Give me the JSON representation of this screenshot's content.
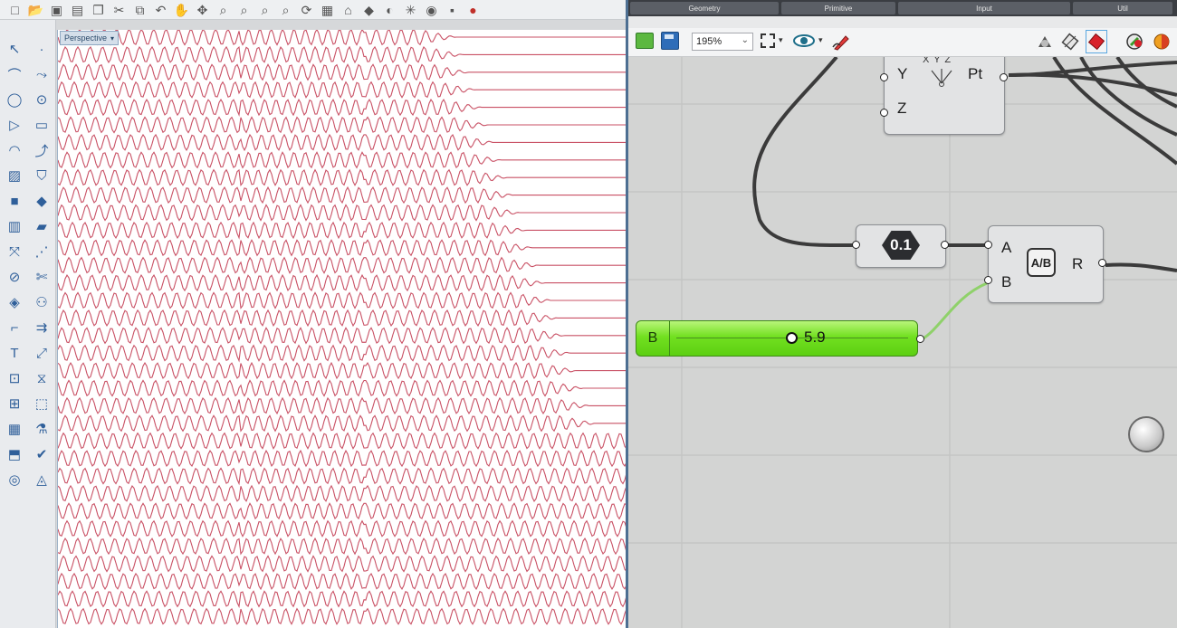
{
  "rhino": {
    "viewport_tab": "Perspective",
    "toolbar_icons": [
      "new-file-icon",
      "open-folder-icon",
      "save-icon",
      "print-icon",
      "paste-icon",
      "cut-icon",
      "copy-icon",
      "undo-icon",
      "pan-hand-icon",
      "move-arrows-icon",
      "zoom-icon",
      "zoom-window-icon",
      "zoom-extents-icon",
      "zoom-selected-icon",
      "rotate-view-icon",
      "grid-icon",
      "set-view-icon",
      "shaded-icon",
      "snapshot-icon",
      "points-icon",
      "light-bulb-icon",
      "lock-icon",
      "render-icon"
    ],
    "side_icons": [
      "select-arrow-icon",
      "point-icon",
      "polyline-icon",
      "curve-tools-icon",
      "circle-icon",
      "ellipse-icon",
      "polygon-icon",
      "rectangle-icon",
      "arc-icon",
      "blend-curve-icon",
      "surface-icon",
      "surface-tools-icon",
      "box-solid-icon",
      "solid-tools-icon",
      "cylinder-icon",
      "mesh-icon",
      "transform-icon",
      "array-icon",
      "split-icon",
      "trim-icon",
      "boolean-icon",
      "group-icon",
      "fillet-icon",
      "offset-icon",
      "text-icon",
      "scale-icon",
      "dimension-icon",
      "analyze-icon",
      "block-icon",
      "layer-icon",
      "grid-array-icon",
      "light-icon",
      "drafting-icon",
      "check-icon",
      "render-icon",
      "material-icon"
    ]
  },
  "grasshopper": {
    "tabs": [
      "Geometry",
      "Primitive",
      "Input",
      "Util"
    ],
    "zoom": "195%",
    "toolbar_right_icons": [
      "preview-none-icon",
      "preview-wire-icon",
      "preview-shaded-icon",
      "preview-selected-icon",
      "material-sphere-icon"
    ],
    "nodes": {
      "construct_point": {
        "inputs": [
          "Y",
          "Z"
        ],
        "output": "Pt",
        "label": "X Y Z"
      },
      "panel_value": "0.1",
      "division": {
        "inputs": [
          "A",
          "B"
        ],
        "output": "R",
        "icon_label": "A/B"
      },
      "slider": {
        "name": "B",
        "value": "5.9"
      }
    }
  },
  "colors": {
    "wave": "#c0324a",
    "slider_green": "#7bea2a",
    "wire": "#3a3a3a",
    "wire_selected": "#8fd16a"
  }
}
